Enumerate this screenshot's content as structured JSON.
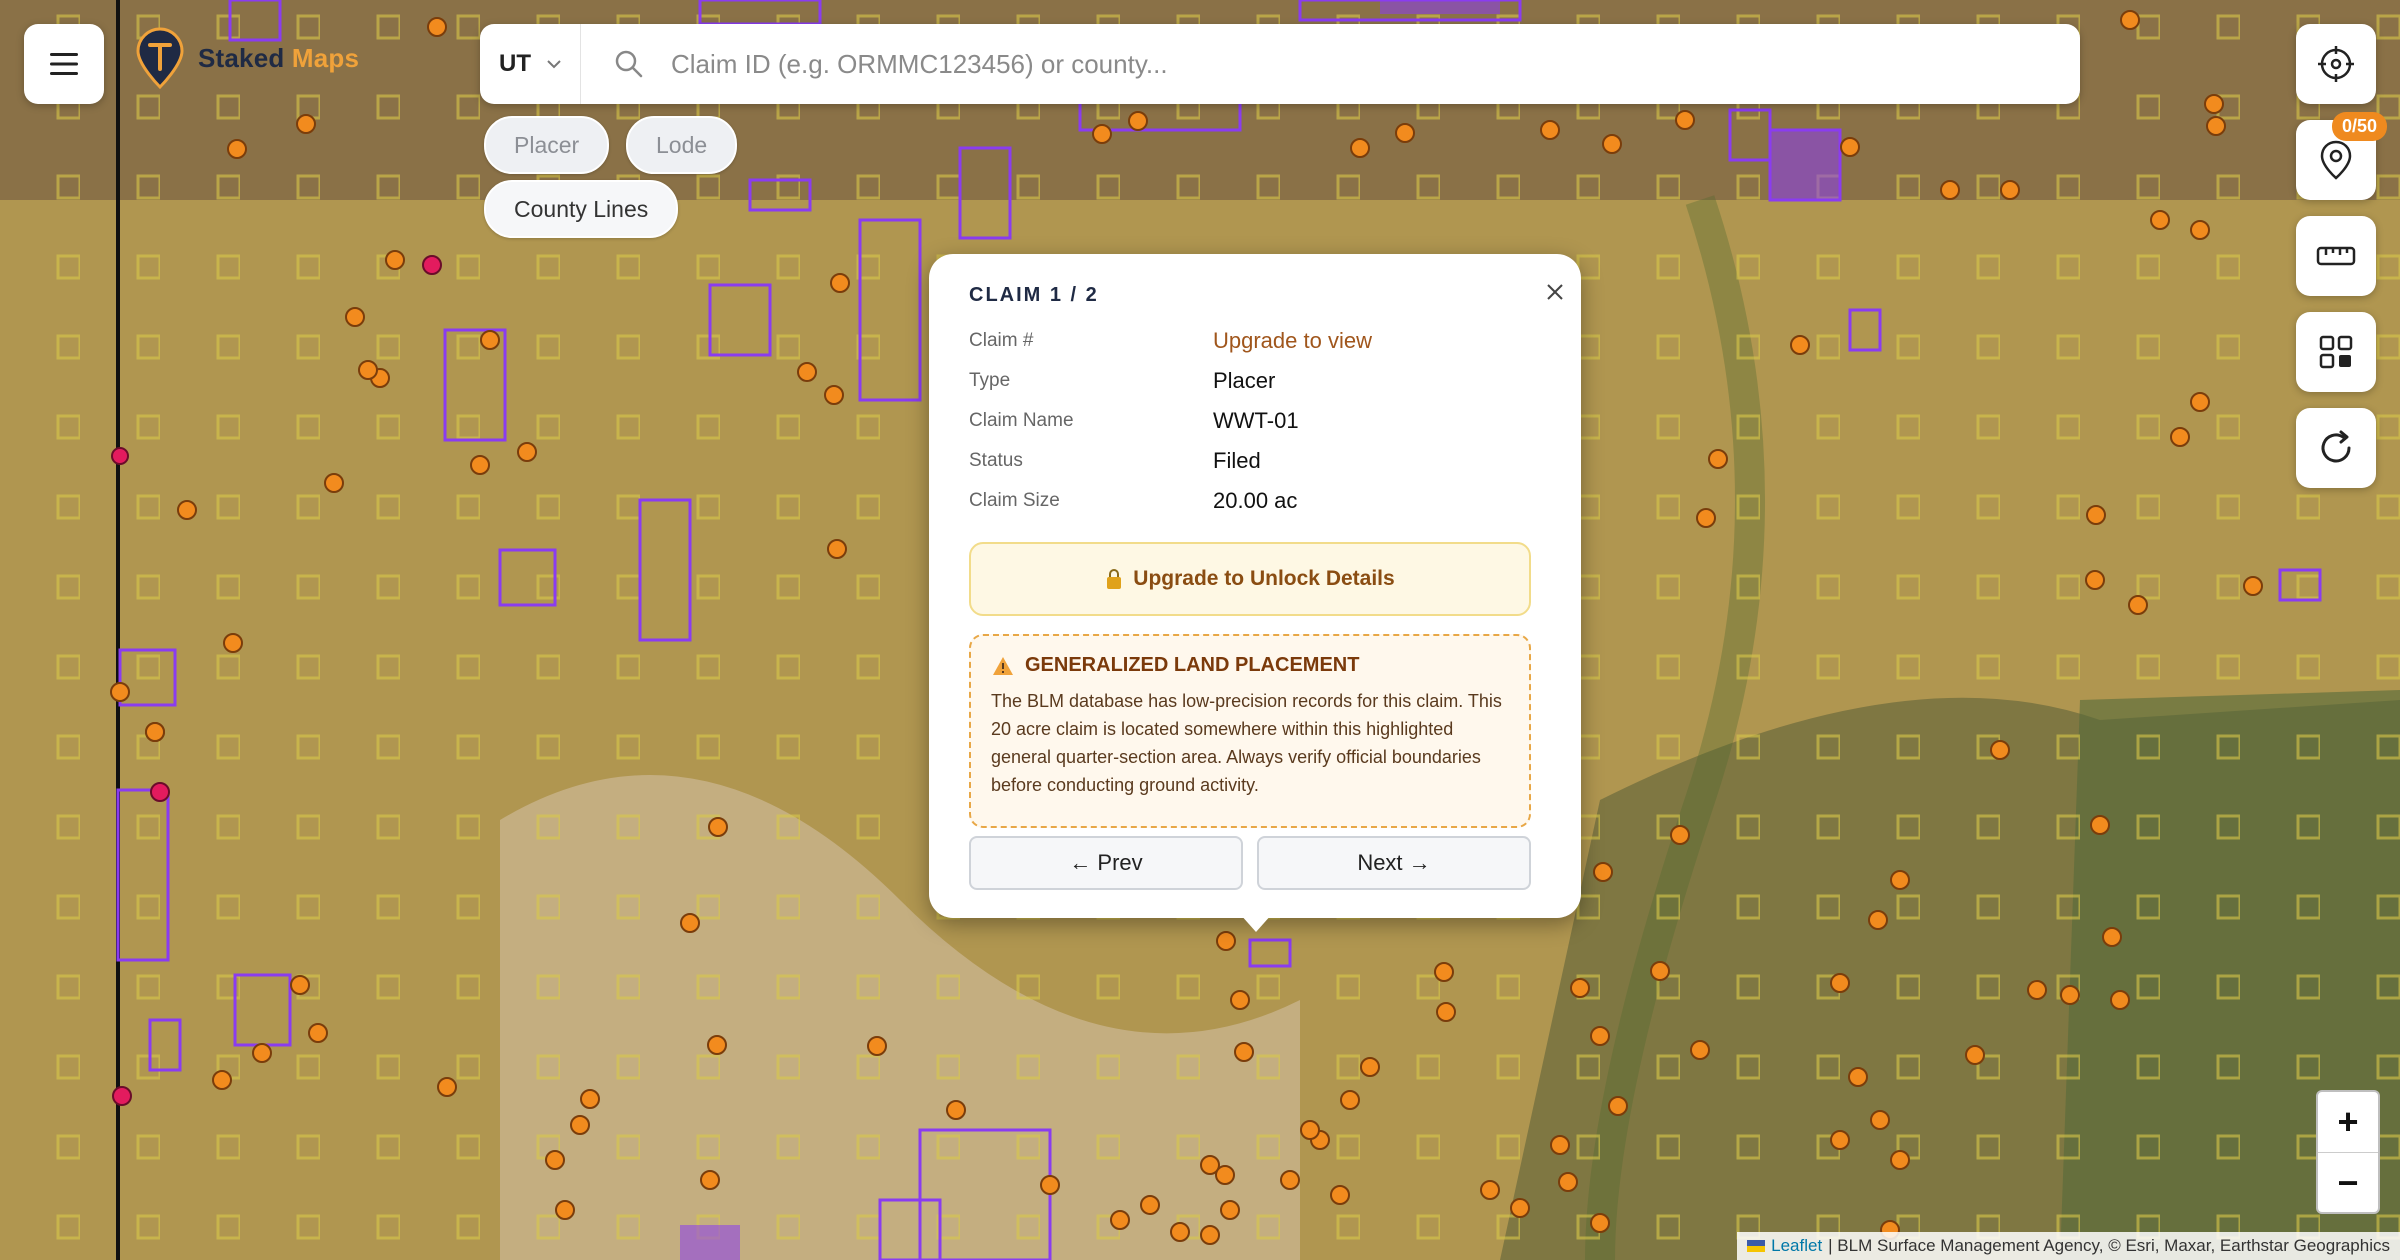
{
  "app": {
    "brand_word1": "Staked",
    "brand_word2": "Maps"
  },
  "search": {
    "state": "UT",
    "placeholder": "Claim ID (e.g. ORMMC123456) or county..."
  },
  "chips": [
    "Placer",
    "Lode",
    "County Lines"
  ],
  "toolbar": {
    "pin_count": "0/50"
  },
  "icons": {
    "menu": "menu-icon",
    "logo": "logo-icon",
    "search": "search-icon",
    "locate": "crosshair-icon",
    "pins": "map-pin-icon",
    "ruler": "ruler-icon",
    "layers": "grid-icon",
    "refresh": "refresh-icon",
    "close": "close-icon",
    "lock": "lock-icon",
    "warning": "warning-icon"
  },
  "popup": {
    "title": "CLAIM 1 / 2",
    "rows": [
      {
        "label": "Claim #",
        "value": "Upgrade to view"
      },
      {
        "label": "Type",
        "value": "Placer"
      },
      {
        "label": "Claim Name",
        "value": "WWT-01"
      },
      {
        "label": "Status",
        "value": "Filed"
      },
      {
        "label": "Claim Size",
        "value": "20.00 ac"
      }
    ],
    "unlock_label": "Upgrade to Unlock Details",
    "warning_title": "GENERALIZED LAND PLACEMENT",
    "warning_body": "The BLM database has low-precision records for this claim. This 20 acre claim is located somewhere within this highlighted general quarter-section area. Always verify official boundaries before conducting ground activity.",
    "prev_label": "← Prev",
    "next_label": "Next →"
  },
  "zoom": {
    "in": "+",
    "out": "−"
  },
  "attribution": {
    "leaflet": "Leaflet",
    "rest": "| BLM Surface Management Agency, © Esri, Maxar, Earthstar Geographics"
  },
  "colors": {
    "accent": "#f0a23a",
    "claim_purple": "#7a3cf0",
    "claim_marker": "#f28b1e",
    "warning": "#e8a746"
  }
}
